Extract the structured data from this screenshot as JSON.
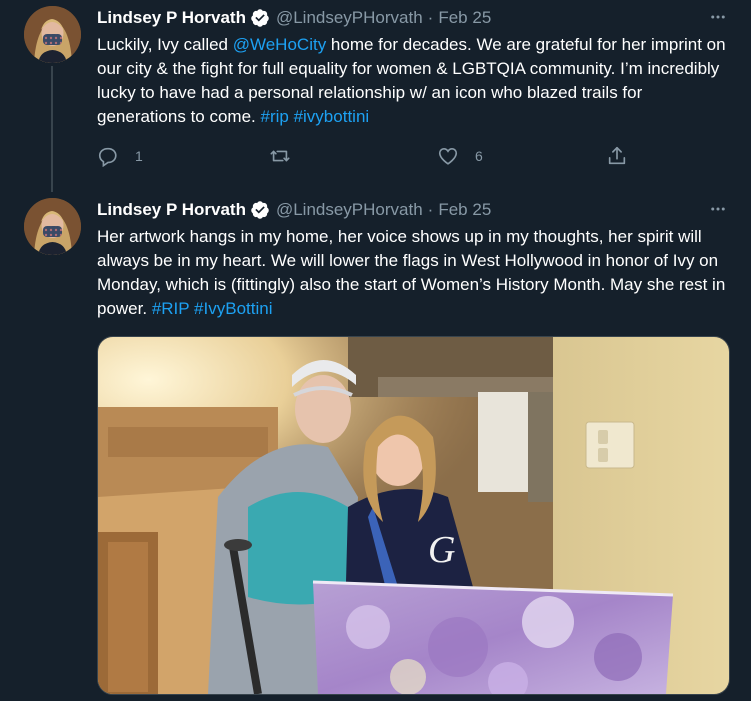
{
  "tweets": [
    {
      "name": "Lindsey P Horvath",
      "handle": "@LindseyPHorvath",
      "separator": "·",
      "date": "Feb 25",
      "text_parts": [
        "Luckily, Ivy called ",
        "@WeHoCity",
        " home for decades. We are grateful for her imprint on our city & the fight for full equality for women & LGBTQIA community. I’m incredibly lucky to have had a personal relationship w/ an icon who blazed trails for generations to come. ",
        "#rip",
        " ",
        "#ivybottini"
      ],
      "reply_count": "1",
      "retweet_count": "",
      "like_count": "6",
      "icons": [
        "verified-badge-icon",
        "more-icon",
        "reply-icon",
        "retweet-icon",
        "like-icon",
        "share-icon"
      ]
    },
    {
      "name": "Lindsey P Horvath",
      "handle": "@LindseyPHorvath",
      "separator": "·",
      "date": "Feb 25",
      "text_parts": [
        "Her artwork hangs in my home, her voice shows up in my thoughts, her spirit will always be in my heart. We will lower the flags in West Hollywood in honor of Ivy on Monday, which is (fittingly) also the start of Women’s History Month. May she rest in power. ",
        "#RIP",
        " ",
        "#IvyBottini"
      ],
      "media": "photo",
      "icons": [
        "verified-badge-icon",
        "more-icon"
      ]
    }
  ],
  "colors": {
    "background": "#15202b",
    "text": "#ffffff",
    "secondary": "#8899a6",
    "link": "#1da1f2",
    "border": "#38444d"
  }
}
